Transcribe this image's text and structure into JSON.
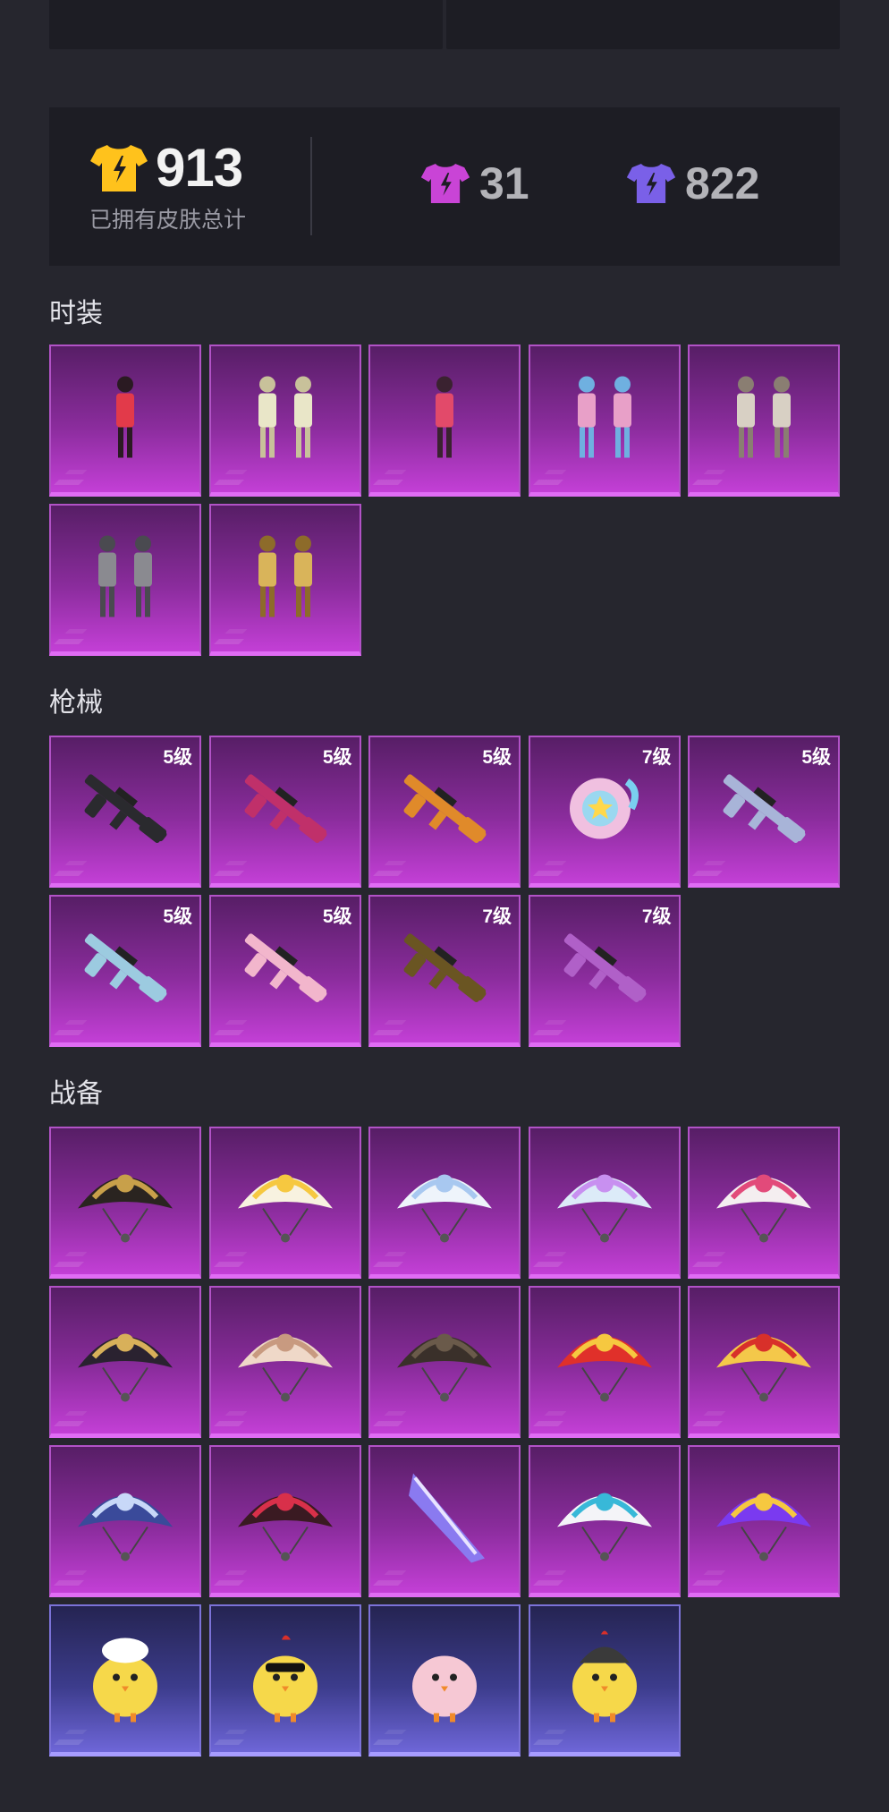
{
  "summary": {
    "total_skins": "913",
    "total_label": "已拥有皮肤总计",
    "rarity_purple_count": "31",
    "rarity_blue_count": "822",
    "colors": {
      "gold": "#ffc21c",
      "magenta": "#c944d6",
      "violet": "#7a60e8"
    }
  },
  "sections": {
    "fashion": {
      "title": "时装",
      "items": [
        {
          "icon": "outfit-red-hair"
        },
        {
          "icon": "outfit-cream-pair"
        },
        {
          "icon": "outfit-pink-dress"
        },
        {
          "icon": "outfit-colorful-pair"
        },
        {
          "icon": "outfit-white-pair"
        },
        {
          "icon": "outfit-grey-bunny-pair"
        },
        {
          "icon": "outfit-gold-pair"
        }
      ]
    },
    "weapons": {
      "title": "枪械",
      "items": [
        {
          "icon": "gun-dark-rifle",
          "level": "5级"
        },
        {
          "icon": "gun-black-pink-smg",
          "level": "5级"
        },
        {
          "icon": "gun-orange-ak",
          "level": "5级"
        },
        {
          "icon": "gun-magic-wand",
          "level": "7级"
        },
        {
          "icon": "gun-silver-sniper",
          "level": "5级"
        },
        {
          "icon": "gun-sky-shotgun",
          "level": "5级"
        },
        {
          "icon": "gun-white-pink-m4",
          "level": "5级"
        },
        {
          "icon": "gun-gold-m416",
          "level": "7级"
        },
        {
          "icon": "gun-pink-rifle",
          "level": "7级"
        }
      ]
    },
    "gear": {
      "title": "战备",
      "items": [
        {
          "icon": "parachute-black-gold",
          "rarity": "purple"
        },
        {
          "icon": "parachute-sheep",
          "rarity": "purple"
        },
        {
          "icon": "parachute-white-cat",
          "rarity": "purple"
        },
        {
          "icon": "parachute-crystal",
          "rarity": "purple"
        },
        {
          "icon": "parachute-pink-cat",
          "rarity": "purple"
        },
        {
          "icon": "parachute-ornate-star",
          "rarity": "purple"
        },
        {
          "icon": "parachute-cream-dome",
          "rarity": "purple"
        },
        {
          "icon": "parachute-dark-camo",
          "rarity": "purple"
        },
        {
          "icon": "parachute-red-bird",
          "rarity": "purple"
        },
        {
          "icon": "parachute-comic",
          "rarity": "purple"
        },
        {
          "icon": "parachute-blue-crystal",
          "rarity": "purple"
        },
        {
          "icon": "parachute-red-black",
          "rarity": "purple"
        },
        {
          "icon": "glider-purple-wing",
          "rarity": "purple"
        },
        {
          "icon": "parachute-white-teal",
          "rarity": "purple"
        },
        {
          "icon": "parachute-purple-logo",
          "rarity": "purple"
        },
        {
          "icon": "chick-chef",
          "rarity": "blue"
        },
        {
          "icon": "chick-sunglasses",
          "rarity": "blue"
        },
        {
          "icon": "chick-pink",
          "rarity": "blue"
        },
        {
          "icon": "chick-helmet",
          "rarity": "blue"
        }
      ]
    }
  }
}
